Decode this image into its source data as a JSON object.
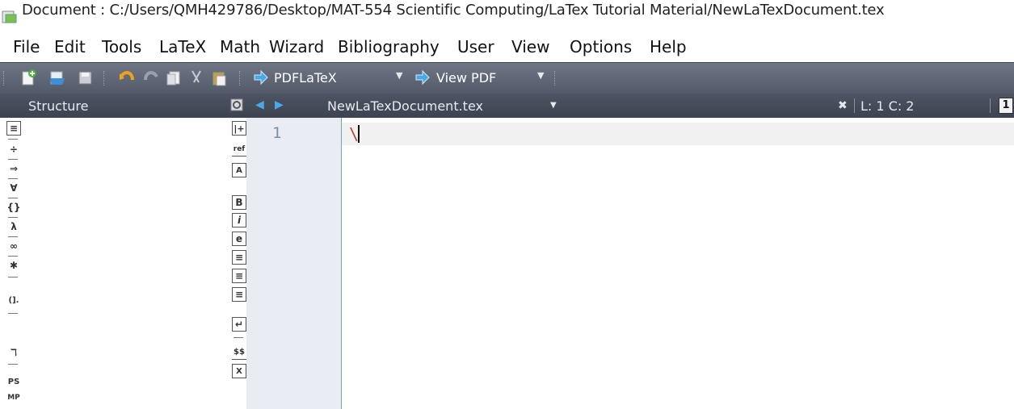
{
  "window": {
    "title": "Document : C:/Users/QMH429786/Desktop/MAT-554 Scientific Computing/LaTex Tutorial Material/NewLaTexDocument.tex"
  },
  "menubar": {
    "items": [
      "File",
      "Edit",
      "Tools",
      "LaTeX",
      "Math",
      "Wizard",
      "Bibliography",
      "User",
      "View",
      "Options",
      "Help"
    ]
  },
  "toolbar": {
    "compile_label": "PDFLaTeX",
    "view_label": "View PDF"
  },
  "structure_panel": {
    "title": "Structure"
  },
  "editor": {
    "tab_filename": "NewLaTexDocument.tex",
    "cursor_position": "L: 1 C: 2",
    "line_number": "1",
    "line_text": "\\",
    "pane_indicator": "1"
  },
  "left_sidebar_icons": [
    "≡",
    "÷",
    "⇒",
    "∀",
    "{}",
    "λ",
    "∞",
    "✱",
    "(].",
    "ℸ",
    "PS",
    "MP"
  ],
  "editor_sidebar_icons": [
    "|+",
    "ref",
    "A",
    "B",
    "i",
    "e",
    "≡",
    "≡",
    "≡",
    "↵",
    "$$",
    "X"
  ]
}
